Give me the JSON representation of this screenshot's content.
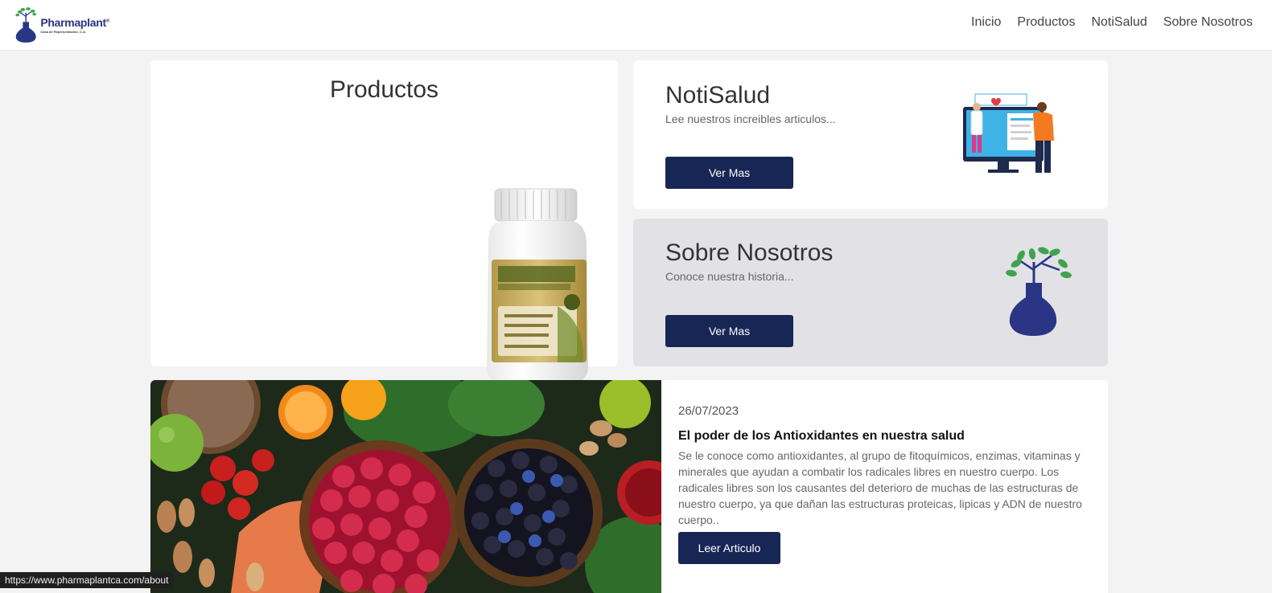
{
  "brand": {
    "name": "Pharmaplant",
    "registered": "®",
    "tagline": "Casa de Representación, C.A."
  },
  "nav": {
    "items": [
      {
        "label": "Inicio"
      },
      {
        "label": "Productos"
      },
      {
        "label": "NotiSalud"
      },
      {
        "label": "Sobre Nosotros"
      }
    ]
  },
  "productos": {
    "title": "Productos",
    "image_icon": "supplement-bottle-icon"
  },
  "notisalud": {
    "title": "NotiSalud",
    "subtitle": "Lee nuestros increibles articulos...",
    "button": "Ver Mas",
    "image_icon": "doctor-consultation-illustration"
  },
  "sobre": {
    "title": "Sobre Nosotros",
    "subtitle": "Conoce nuestra historia...",
    "button": "Ver Mas",
    "image_icon": "plant-flask-logo-icon"
  },
  "article": {
    "date": "26/07/2023",
    "title": "El poder de los Antioxidantes en nuestra salud",
    "excerpt": "Se le conoce como antioxidantes, al grupo de fitoquímicos, enzimas, vitaminas y minerales que ayudan a combatir los radicales libres en nuestro cuerpo. Los radicales libres son los causantes del deterioro de muchas de las estructuras de nuestro cuerpo, ya que dañan las estructuras proteicas, lipicas y ADN de nuestro cuerpo..",
    "button": "Leer Articulo",
    "image_icon": "fruits-vegetables-photo"
  },
  "status_bar": {
    "url": "https://www.pharmaplantca.com/about"
  },
  "colors": {
    "brand_navy": "#182656",
    "logo_blue": "#2a3585",
    "leaf_green": "#3fa34d",
    "page_bg": "#f3f3f3"
  }
}
